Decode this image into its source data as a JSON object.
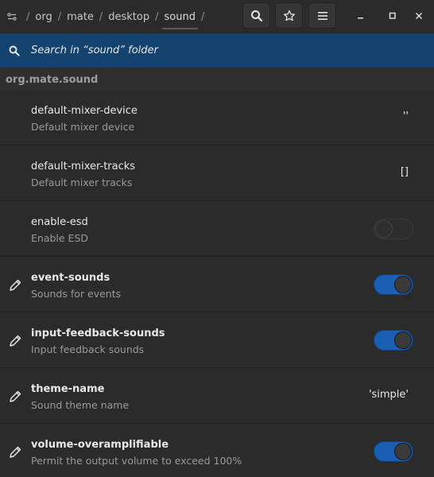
{
  "header": {
    "path": [
      {
        "label": "org"
      },
      {
        "label": "mate"
      },
      {
        "label": "desktop"
      },
      {
        "label": "sound"
      }
    ],
    "separator": "/",
    "icons": {
      "home": "dconf-root-icon",
      "search": "search-icon",
      "bookmark": "star-icon",
      "menu": "hamburger-menu-icon",
      "minimize": "minimize-icon",
      "maximize": "maximize-icon",
      "close": "close-icon"
    }
  },
  "search": {
    "placeholder": "Search in “sound” folder"
  },
  "section": {
    "title": "org.mate.sound"
  },
  "rows": [
    {
      "key": "default-mixer-device",
      "description": "Default mixer device",
      "value": "''",
      "kind": "text",
      "modified": false
    },
    {
      "key": "default-mixer-tracks",
      "description": "Default mixer tracks",
      "value": "[]",
      "kind": "text",
      "modified": false
    },
    {
      "key": "enable-esd",
      "description": "Enable ESD",
      "value": false,
      "kind": "toggle",
      "modified": false
    },
    {
      "key": "event-sounds",
      "description": "Sounds for events",
      "value": true,
      "kind": "toggle",
      "modified": true
    },
    {
      "key": "input-feedback-sounds",
      "description": "Input feedback sounds",
      "value": true,
      "kind": "toggle",
      "modified": true
    },
    {
      "key": "theme-name",
      "description": "Sound theme name",
      "value": "'simple'",
      "kind": "text",
      "modified": true
    },
    {
      "key": "volume-overamplifiable",
      "description": "Permit the output volume to exceed 100%",
      "value": true,
      "kind": "toggle",
      "modified": true
    }
  ],
  "colors": {
    "accent": "#1a5fb4",
    "searchbar": "#144370",
    "background": "#2b2b2b"
  }
}
